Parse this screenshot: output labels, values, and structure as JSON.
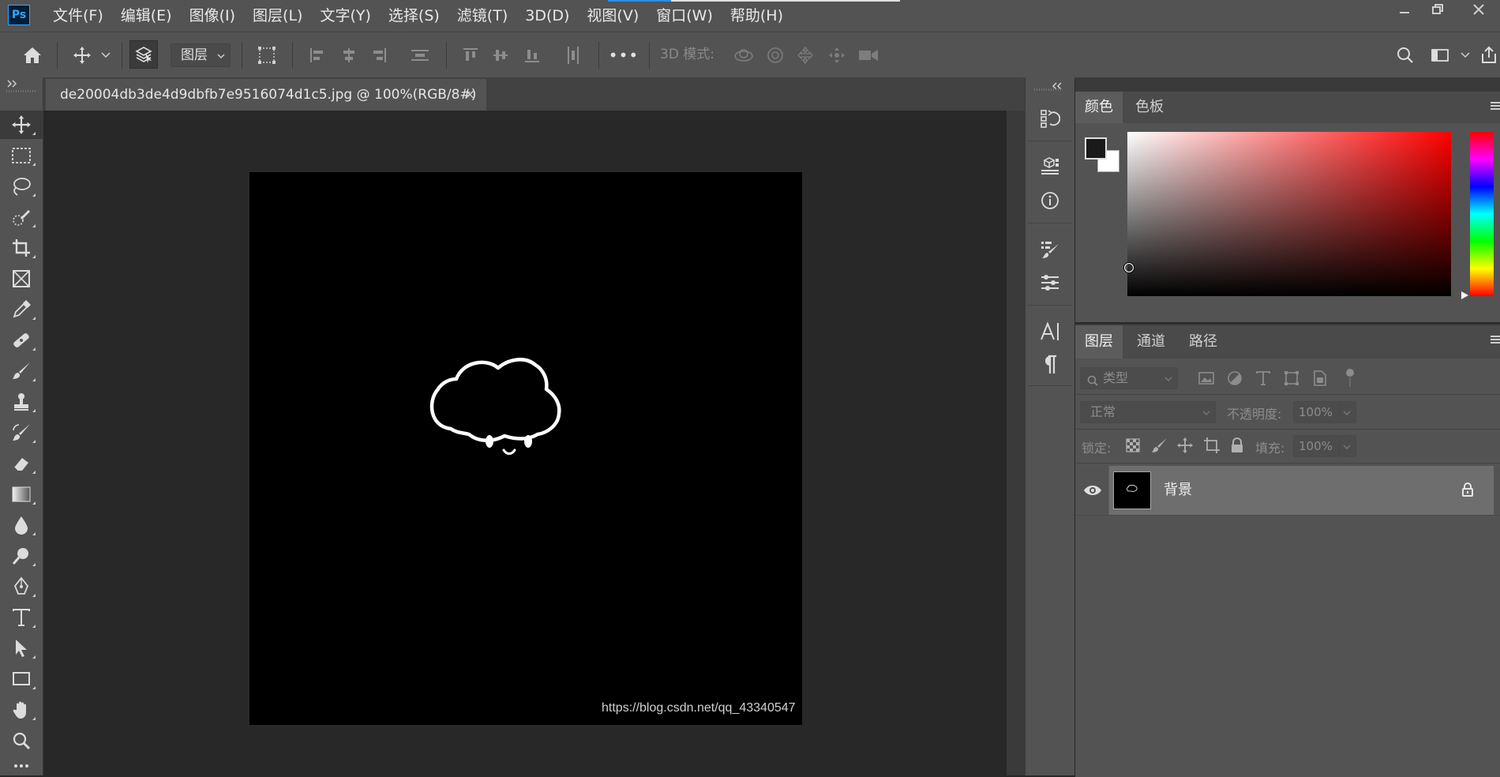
{
  "app": {
    "logo_text": "Ps",
    "menus": [
      "文件(F)",
      "编辑(E)",
      "图像(I)",
      "图层(L)",
      "文字(Y)",
      "选择(S)",
      "滤镜(T)",
      "3D(D)",
      "视图(V)",
      "窗口(W)",
      "帮助(H)"
    ],
    "window_controls": {
      "minimize_icon": "minimize-icon",
      "restore_icon": "restore-icon",
      "close_icon": "close-icon"
    }
  },
  "options_bar": {
    "auto_select_target": "图层",
    "mode_3d_label": "3D 模式:",
    "more_label": "•••"
  },
  "document": {
    "tab_title": "de20004db3de4d9dbfb7e9516074d1c5.jpg @ 100%(RGB/8#)",
    "tab_close": "×",
    "watermark": "https://blog.csdn.net/qq_43340547"
  },
  "color_panel": {
    "tabs": [
      "颜色",
      "色板"
    ],
    "active_tab": "颜色",
    "foreground_color": "#1a1a1a",
    "background_color": "#ffffff",
    "hue_color": "#ff0000"
  },
  "layers_panel": {
    "tabs": [
      "图层",
      "通道",
      "路径"
    ],
    "active_tab": "图层",
    "filter_kind": "类型",
    "blend_mode": "正常",
    "opacity_label": "不透明度:",
    "opacity_value": "100%",
    "lock_label": "锁定:",
    "fill_label": "填充:",
    "fill_value": "100%",
    "layers": [
      {
        "name": "背景",
        "visible": true,
        "locked": true
      }
    ]
  },
  "colors": {
    "ui_bg": "#535353",
    "canvas_bg": "#282828",
    "accent": "#31a8ff"
  }
}
